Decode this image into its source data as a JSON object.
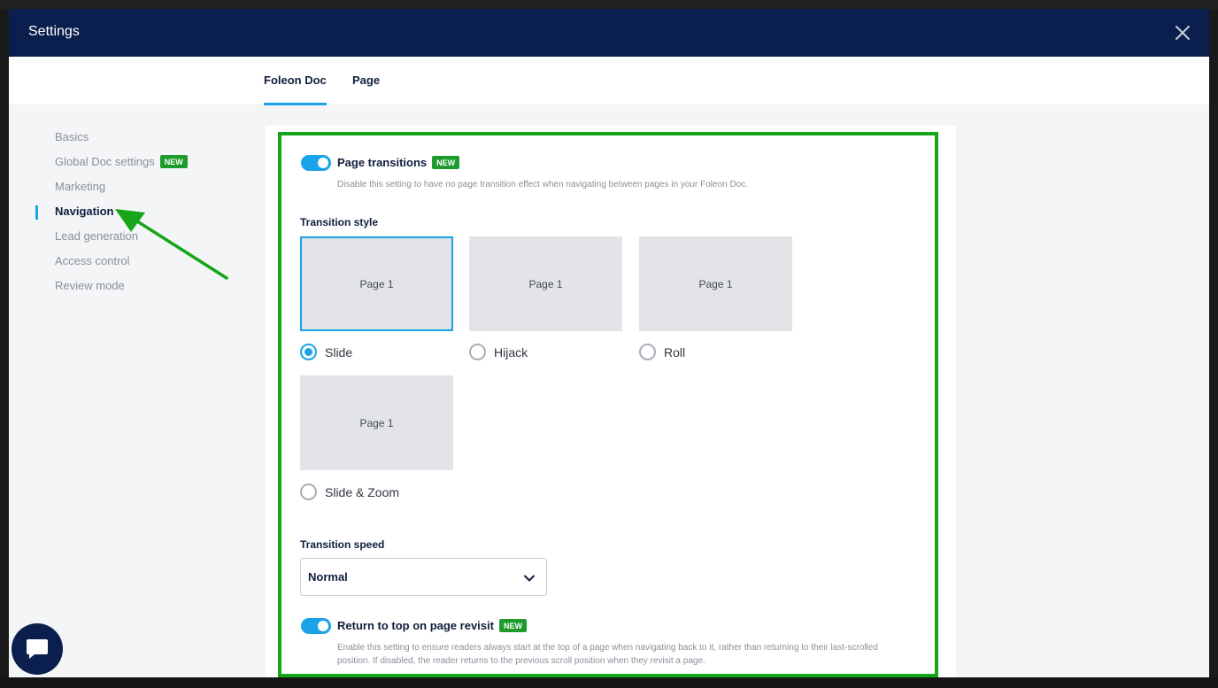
{
  "modal": {
    "title": "Settings",
    "close_icon": "close-icon"
  },
  "tabs": [
    {
      "label": "Foleon Doc",
      "active": true
    },
    {
      "label": "Page",
      "active": false
    }
  ],
  "sidebar": {
    "items": [
      {
        "label": "Basics",
        "badge": ""
      },
      {
        "label": "Global Doc settings",
        "badge": "NEW"
      },
      {
        "label": "Marketing",
        "badge": ""
      },
      {
        "label": "Navigation",
        "badge": "",
        "active": true
      },
      {
        "label": "Lead generation",
        "badge": ""
      },
      {
        "label": "Access control",
        "badge": ""
      },
      {
        "label": "Review mode",
        "badge": ""
      }
    ]
  },
  "page_transitions": {
    "label": "Page transitions",
    "badge": "NEW",
    "enabled": true,
    "description": "Disable this setting to have no page transition effect when navigating between pages in your Foleon Doc."
  },
  "transition_style": {
    "label": "Transition style",
    "options": [
      {
        "thumb": "Page 1",
        "label": "Slide",
        "checked": true
      },
      {
        "thumb": "Page 1",
        "label": "Hijack",
        "checked": false
      },
      {
        "thumb": "Page 1",
        "label": "Roll",
        "checked": false
      },
      {
        "thumb": "Page 1",
        "label": "Slide & Zoom",
        "checked": false
      }
    ]
  },
  "transition_speed": {
    "label": "Transition speed",
    "value": "Normal"
  },
  "return_to_top": {
    "label": "Return to top on page revisit",
    "badge": "NEW",
    "enabled": true,
    "description_line1": "Enable this setting to ensure readers always start at the top of a page when navigating back to it, rather than returning to their last-scrolled",
    "description_line2": "position. If disabled, the reader returns to the previous scroll position when they revisit a page."
  },
  "colors": {
    "header_bg": "#0a1f4d",
    "accent": "#1aa3e8",
    "badge_green": "#1e9b2c",
    "annotation_green": "#16a517"
  }
}
